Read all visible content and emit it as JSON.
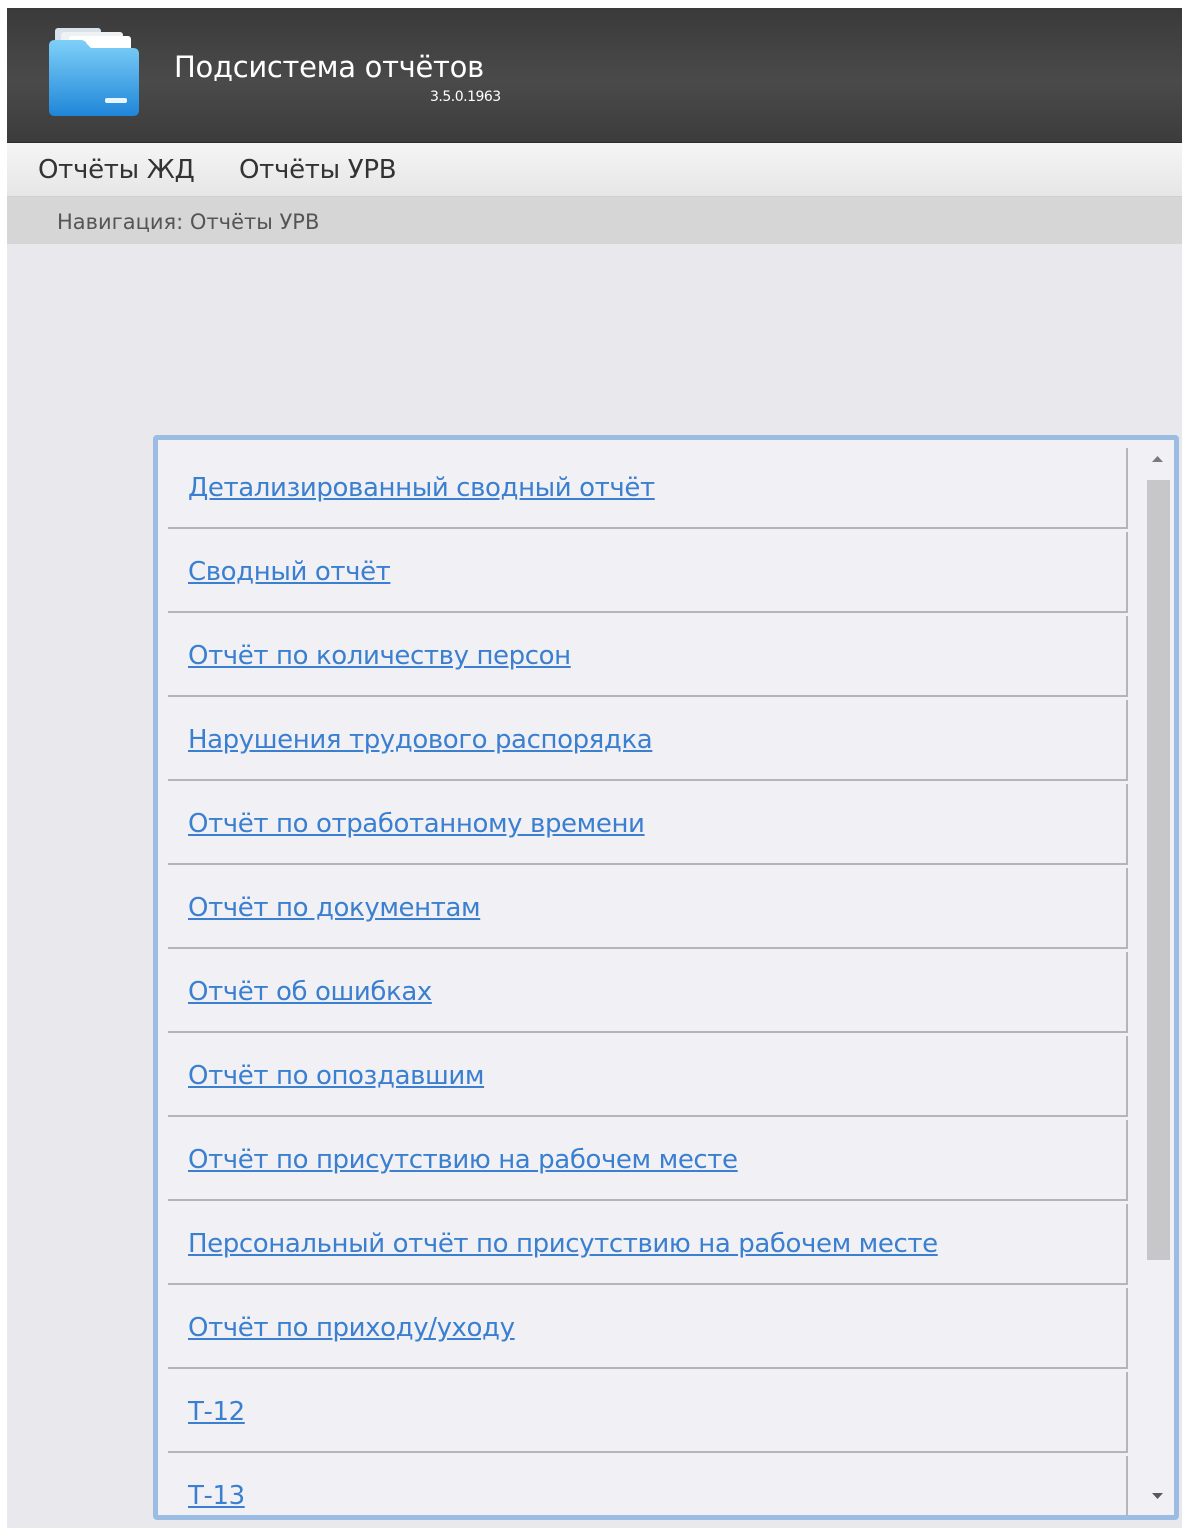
{
  "header": {
    "title": "Подсистема отчётов",
    "version": "3.5.0.1963",
    "logo_icon": "folder-icon"
  },
  "menu": {
    "items": [
      {
        "label": "Отчёты ЖД"
      },
      {
        "label": "Отчёты УРВ"
      }
    ]
  },
  "navigation": {
    "text": "Навигация: Отчёты УРВ"
  },
  "reports": [
    {
      "label": "Детализированный сводный отчёт"
    },
    {
      "label": "Сводный отчёт"
    },
    {
      "label": "Отчёт по количеству персон"
    },
    {
      "label": "Нарушения трудового распорядка"
    },
    {
      "label": "Отчёт по отработанному времени"
    },
    {
      "label": "Отчёт по документам"
    },
    {
      "label": "Отчёт об ошибках"
    },
    {
      "label": "Отчёт по опоздавшим"
    },
    {
      "label": "Отчёт по присутствию на рабочем месте"
    },
    {
      "label": "Персональный отчёт по присутствию на рабочем месте"
    },
    {
      "label": "Отчёт по приходу/уходу"
    },
    {
      "label": "Т-12"
    },
    {
      "label": "Т-13"
    }
  ],
  "colors": {
    "link": "#3a7fd0",
    "panel_border": "#9bbce3",
    "header_bg": "#424242"
  }
}
